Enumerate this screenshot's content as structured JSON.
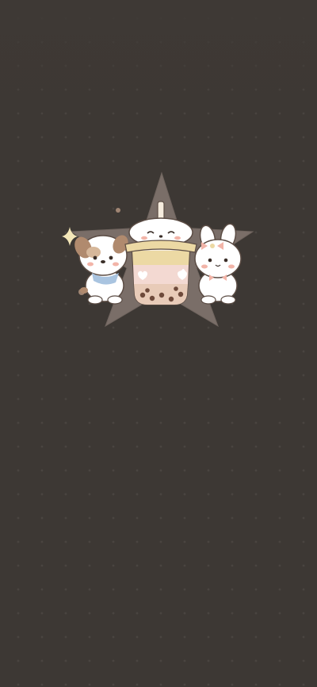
{
  "wallpaper": {
    "description_colors": {
      "background": "#3d3834",
      "dot": "#4a4440",
      "star": "#7a6e68",
      "boba_milk": "#f3d9d2",
      "boba_lid": "#ecd9a4",
      "pearls": "#6e4a3b",
      "dog_patch": "#b08a6e",
      "bunny_bow": "#f2b4a8",
      "sparkle": "#f3e6b8"
    },
    "icons": [
      "star-shape",
      "dog-character",
      "boba-cup-character",
      "bunny-character",
      "sparkle-icon"
    ]
  }
}
